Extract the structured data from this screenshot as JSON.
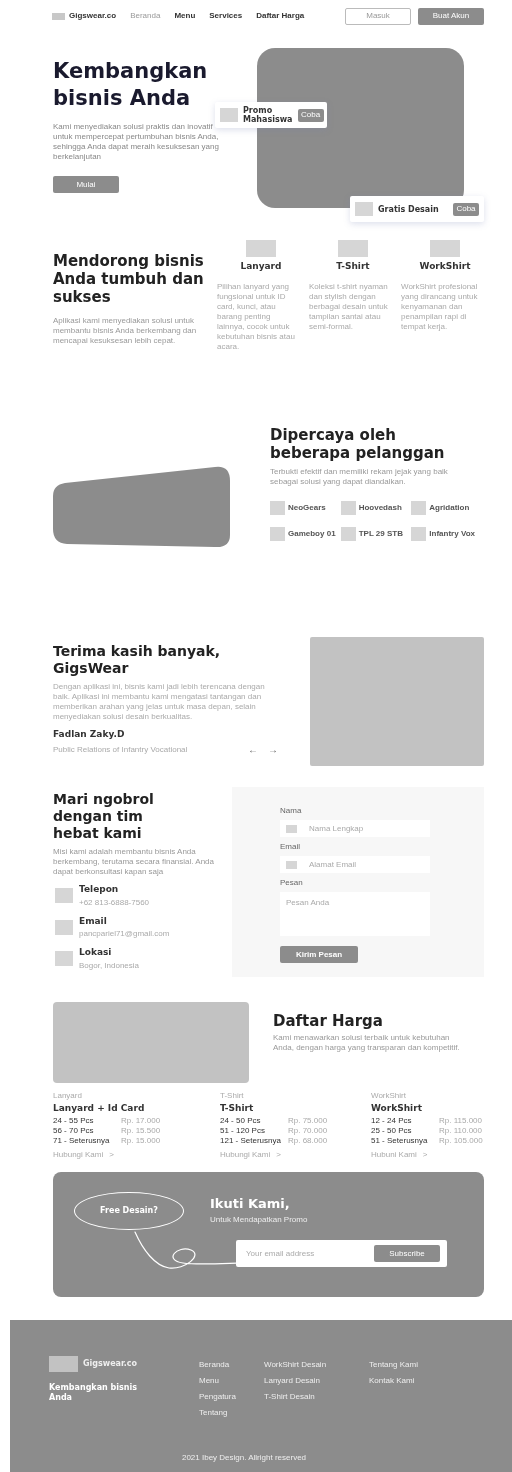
{
  "nav": {
    "logo": "Gigswear.co",
    "links": [
      "Beranda",
      "Menu",
      "Services",
      "Daftar Harga"
    ],
    "login": "Masuk",
    "signup": "Buat Akun"
  },
  "hero": {
    "title_lines": [
      "Kembangkan",
      "bisnis Anda"
    ],
    "description": "Kami menyediakan solusi praktis dan inovatif untuk mempercepat pertumbuhan bisnis Anda, sehingga Anda dapat meraih kesuksesan yang berkelanjutan",
    "button": "Mulai",
    "promos": [
      {
        "label": "Promo Mahasiswa",
        "button": "Coba"
      },
      {
        "label": "Gratis Desain",
        "button": "Coba"
      }
    ]
  },
  "features": {
    "title": "Mendorong bisnis Anda tumbuh dan sukses",
    "description": "Aplikasi kami menyediakan solusi untuk membantu bisnis Anda berkembang dan mencapai kesuksesan lebih cepat.",
    "items": [
      {
        "title": "Lanyard",
        "description": "Pilihan lanyard yang fungsional untuk ID card, kunci, atau barang penting lainnya, cocok untuk kebutuhan bisnis atau acara."
      },
      {
        "title": "T-Shirt",
        "description": "Koleksi t-shirt nyaman dan stylish dengan berbagai desain untuk tampilan santai atau semi-formal."
      },
      {
        "title": "WorkShirt",
        "description": "WorkShirt profesional yang dirancang untuk kenyamanan dan penampilan rapi di tempat kerja."
      }
    ]
  },
  "clients": {
    "title": "Dipercaya oleh beberapa pelanggan",
    "description": "Terbukti efektif dan memiliki rekam jejak yang baik sebagai solusi yang dapat diandalkan.",
    "logos": [
      "NeoGears",
      "Hoovedash",
      "Agridation",
      "Gameboy 01",
      "TPL 29 STB",
      "Infantry Vox"
    ]
  },
  "testimonial": {
    "title": "Terima kasih banyak, GigsWear",
    "quote": "Dengan aplikasi ini, bisnis kami jadi lebih terencana dengan baik. Aplikasi ini membantu kami mengatasi tantangan dan memberikan arahan yang jelas untuk masa depan, selain menyediakan solusi desain berkualitas.",
    "name": "Fadlan Zaky.D",
    "role": "Public Relations of Infantry Vocational",
    "prev": "←",
    "next": "→"
  },
  "contact": {
    "title": "Mari ngobrol dengan tim hebat kami",
    "description": "Misi kami adalah membantu bisnis Anda berkembang, terutama secara finansial. Anda dapat berkonsultasi kapan saja",
    "channels": [
      {
        "label": "Telepon",
        "value": "+62 813-6888-7560"
      },
      {
        "label": "Email",
        "value": "pancpariel71@gmail.com"
      },
      {
        "label": "Lokasi",
        "value": "Bogor, Indonesia"
      }
    ],
    "form": {
      "fields": [
        {
          "kind": "input",
          "label": "Nama",
          "placeholder": "Nama Lengkap"
        },
        {
          "kind": "input",
          "label": "Email",
          "placeholder": "Alamat Email"
        },
        {
          "kind": "textarea",
          "label": "Pesan",
          "placeholder": "Pesan Anda"
        }
      ],
      "button": "Kirim Pesan"
    }
  },
  "pricing": {
    "title": "Daftar Harga",
    "description": "Kami menawarkan solusi terbaik untuk kebutuhan Anda, dengan harga yang transparan dan kompetitif.",
    "plans": [
      {
        "category": "Lanyard",
        "title": "Lanyard + Id Card",
        "rows": [
          [
            "24 - 55 Pcs",
            "Rp. 17.000"
          ],
          [
            "56 - 70 Pcs",
            "Rp. 15.500"
          ],
          [
            "71 - Seterusnya",
            "Rp. 15.000"
          ]
        ],
        "link": "Hubungi Kami",
        "link_icon": ">"
      },
      {
        "category": "T-Shirt",
        "title": "T-Shirt",
        "rows": [
          [
            "24 - 50 Pcs",
            "Rp. 75.000"
          ],
          [
            "51 - 120 Pcs",
            "Rp. 70.000"
          ],
          [
            "121 - Seterusnya",
            "Rp. 68.000"
          ]
        ],
        "link": "Hubungi Kami",
        "link_icon": ">"
      },
      {
        "category": "WorkShirt",
        "title": "WorkShirt",
        "rows": [
          [
            "12 - 24 Pcs",
            "Rp. 115.000"
          ],
          [
            "25 - 50 Pcs",
            "Rp. 110.000"
          ],
          [
            "51 - Seterusnya",
            "Rp. 105.000"
          ]
        ],
        "link": "Hubuni Kami",
        "link_icon": ">"
      }
    ]
  },
  "subscribe": {
    "badge": "Free Desain?",
    "title": "Ikuti Kami,",
    "subtitle": "Untuk Mendapatkan Promo",
    "placeholder": "Your email address",
    "button": "Subscribe"
  },
  "footer": {
    "logo": "Gigswear.co",
    "tagline": "Kembangkan bisnis Anda",
    "columns": [
      [
        "Beranda",
        "Menu",
        "Pengatura",
        "Tentang"
      ],
      [
        "WorkShirt Desain",
        "Lanyard Desain",
        "T-Shirt Desain"
      ],
      [
        "Tentang Kami",
        "Kontak Kami"
      ]
    ],
    "copyright": "2021 Ibey Design. Allright reserved"
  }
}
